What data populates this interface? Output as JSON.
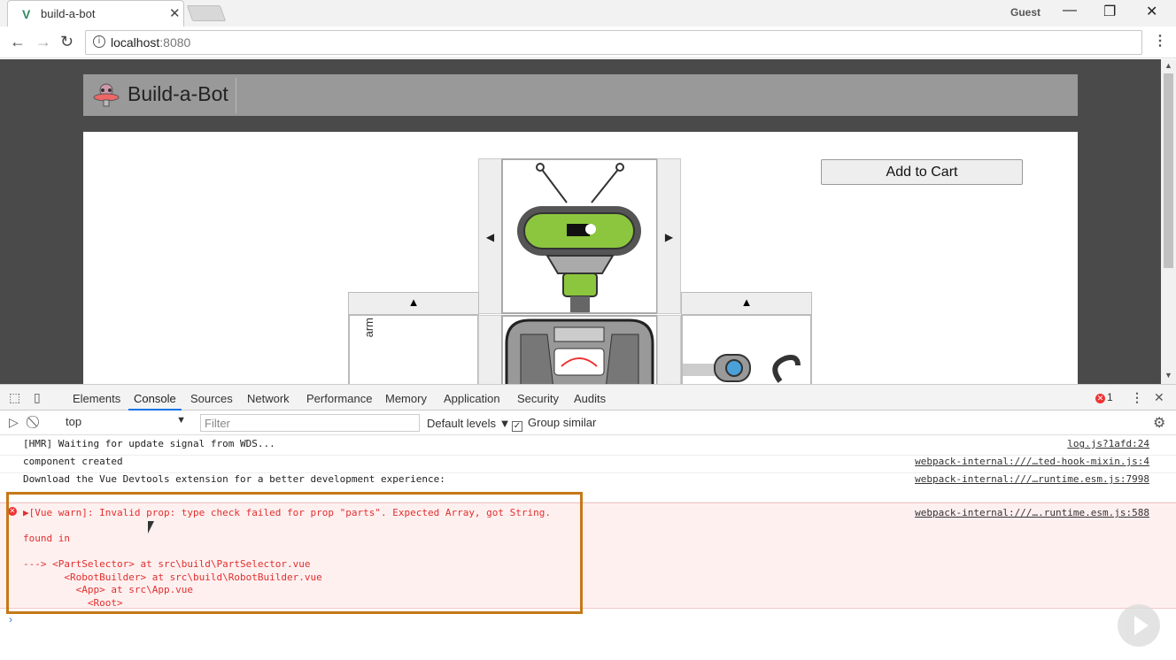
{
  "browser": {
    "tab_title": "build-a-bot",
    "tab_close": "✕",
    "profile": "Guest",
    "url_host": "localhost",
    "url_port": ":8080"
  },
  "app": {
    "brand": "Build-a-Bot",
    "add_to_cart": "Add to Cart",
    "left_arrow": "◀",
    "right_arrow": "▶",
    "up_arrow": "▲",
    "broken_image_alt": "arm"
  },
  "devtools": {
    "tabs": [
      "Elements",
      "Console",
      "Sources",
      "Network",
      "Performance",
      "Memory",
      "Application",
      "Security",
      "Audits"
    ],
    "active_tab": "Console",
    "error_count": "1",
    "context": "top",
    "filter_placeholder": "Filter",
    "levels": "Default levels",
    "group_similar": "Group similar",
    "logs": [
      {
        "msg": "[HMR] Waiting for update signal from WDS...",
        "src": "log.js?1afd:24"
      },
      {
        "msg": "component created",
        "src": "webpack-internal:///…ted-hook-mixin.js:4"
      },
      {
        "msg": "Download the Vue Devtools extension for a better development experience:",
        "src": "webpack-internal:///…runtime.esm.js:7998"
      }
    ],
    "error": {
      "line1": "▶[Vue warn]: Invalid prop: type check failed for prop \"parts\". Expected Array, got String.",
      "line2": "found in",
      "line3": "---> <PartSelector> at src\\build\\PartSelector.vue",
      "line4": "       <RobotBuilder> at src\\build\\RobotBuilder.vue",
      "line5": "         <App> at src\\App.vue",
      "line6": "           <Root>",
      "src": "webpack-internal:///….runtime.esm.js:588"
    },
    "prompt": "›"
  }
}
